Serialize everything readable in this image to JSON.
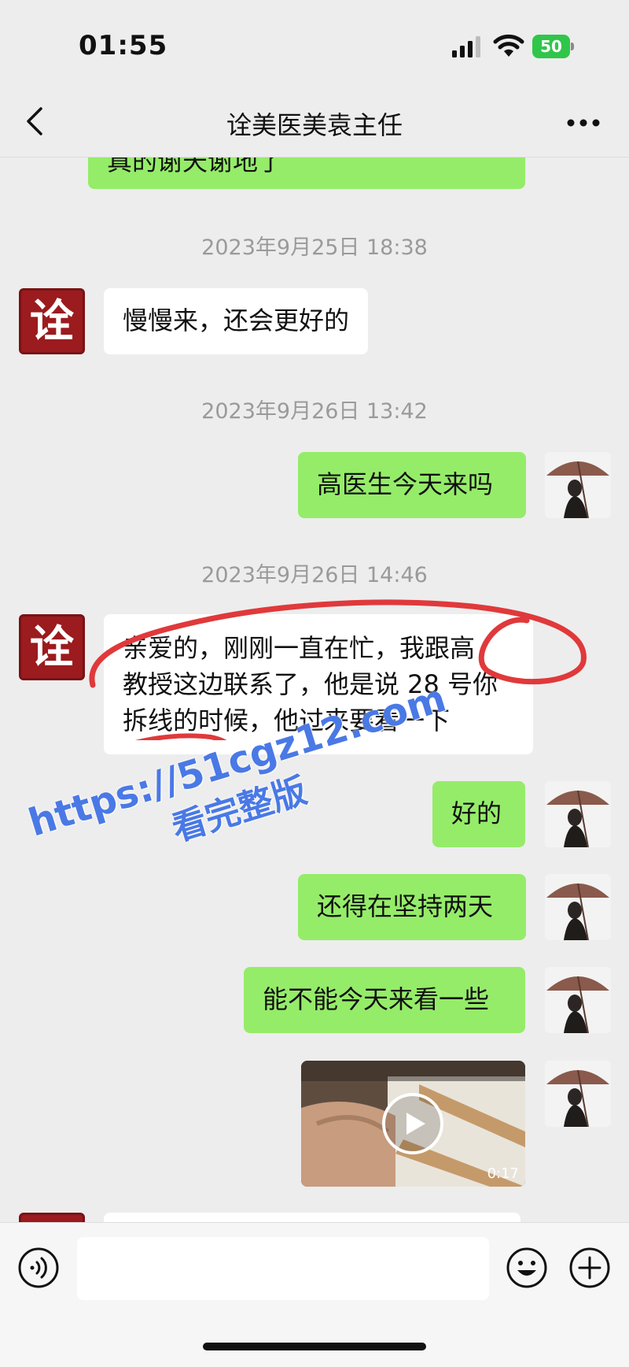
{
  "status_bar": {
    "time": "01:55",
    "battery": "50"
  },
  "header": {
    "title": "诠美医美袁主任"
  },
  "org_avatar_glyph": "诠",
  "messages": {
    "m0": "真的谢天谢地了",
    "t1": "2023年9月25日 18:38",
    "m1": "慢慢来，还会更好的",
    "t2": "2023年9月26日 13:42",
    "m2": "高医生今天来吗",
    "t3": "2023年9月26日 14:46",
    "m3_line1": "亲爱的，刚刚一直在忙，我跟高",
    "m3_line2": "教授这边联系了，他是说 28 号你",
    "m3_line3": "拆线的时候，他过来要看一下",
    "m4": "好的",
    "m5": "还得在坚持两天",
    "m6": "能不能今天来看一些",
    "video_duration": "0:17"
  },
  "watermark": {
    "line1": "https://51cgz12.com",
    "line2": "看完整版"
  },
  "colors": {
    "sent_bubble": "#95ec69",
    "received_bubble": "#ffffff",
    "annotation": "#e0393b",
    "watermark": "#4a79e6"
  }
}
